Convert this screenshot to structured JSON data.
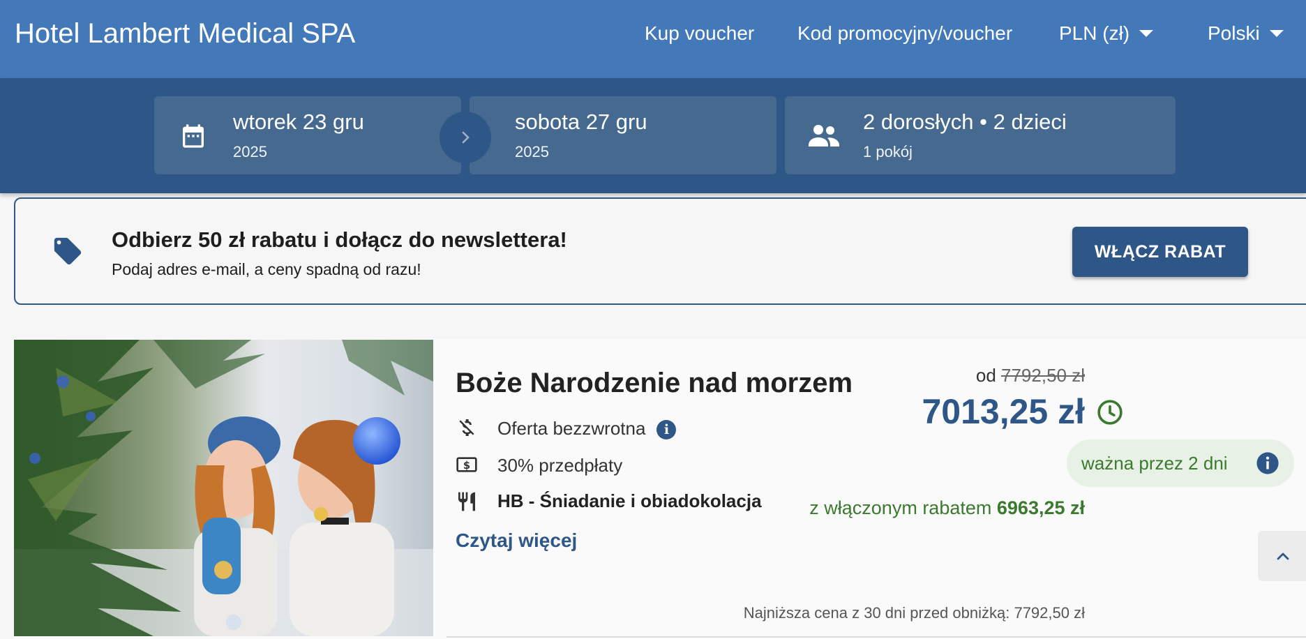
{
  "header": {
    "brand": "Hotel Lambert Medical SPA",
    "nav": {
      "voucher": "Kup voucher",
      "promo": "Kod promocyjny/voucher",
      "currency": "PLN (zł)",
      "language": "Polski"
    }
  },
  "search": {
    "checkin": {
      "day": "wtorek 23 gru",
      "year": "2025",
      "icon": "calendar-icon"
    },
    "checkout": {
      "day": "sobota 27 gru",
      "year": "2025"
    },
    "guests": {
      "summary": "2 dorosłych • 2 dzieci",
      "rooms": "1 pokój",
      "icon": "people-icon"
    }
  },
  "newsletter": {
    "title": "Odbierz 50 zł rabatu i dołącz do newslettera!",
    "subtitle": "Podaj adres e-mail, a ceny spadną od razu!",
    "button": "WŁĄCZ RABAT",
    "icon": "tag-icon"
  },
  "offer": {
    "title": "Boże Narodzenie nad morzem",
    "features": [
      {
        "icon": "no-money-icon",
        "label": "Oferta bezzwrotna",
        "info": "i"
      },
      {
        "icon": "banknote-icon",
        "label": "30% przedpłaty"
      },
      {
        "icon": "cutlery-icon",
        "label": "HB - Śniadanie i obiadokolacja"
      }
    ],
    "read_more": "Czytaj więcej",
    "from_label": "od",
    "old_price": "7792,50 zł",
    "price": "7013,25 zł",
    "valid": "ważna przez 2 dni",
    "valid_info": "i",
    "discount_label": "z włączonym rabatem",
    "discount_price": "6963,25 zł",
    "lowest": "Najniższa cena z 30 dni przed obniżką: 7792,50 zł"
  },
  "colors": {
    "header": "#4379b9",
    "searchbar": "#2e5787",
    "accent": "#2e5787",
    "green": "#3b7a2e"
  }
}
